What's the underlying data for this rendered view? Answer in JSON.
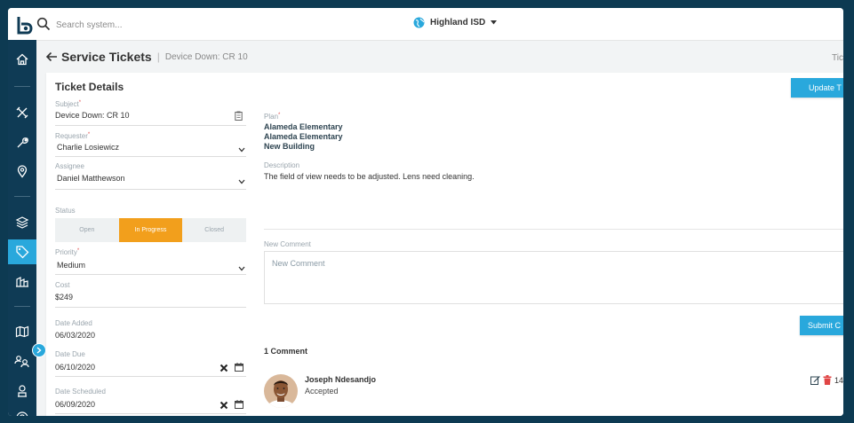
{
  "topbar": {
    "search_placeholder": "Search system...",
    "org_name": "Highland ISD"
  },
  "sidebar": {
    "items": [
      {
        "icon": "home-icon"
      },
      {
        "icon": "tools-icon"
      },
      {
        "icon": "wrench-icon"
      },
      {
        "icon": "location-pin-icon"
      },
      {
        "icon": "layers-icon"
      },
      {
        "icon": "tag-icon",
        "active": true
      },
      {
        "icon": "buildings-icon"
      },
      {
        "icon": "map-icon"
      },
      {
        "icon": "people-icon"
      },
      {
        "icon": "badge-icon"
      },
      {
        "icon": "help-icon"
      }
    ]
  },
  "header": {
    "title": "Service Tickets",
    "subtitle": "Device Down: CR 10",
    "right_clip": "Tic"
  },
  "ticket": {
    "card_title": "Ticket Details",
    "update_label": "Update T",
    "subject_label": "Subject",
    "subject_value": "Device Down: CR 10",
    "requester_label": "Requester",
    "requester_value": "Charlie Losiewicz",
    "assignee_label": "Assignee",
    "assignee_value": "Daniel Matthewson",
    "status_label": "Status",
    "status_options": [
      "Open",
      "In Progress",
      "Closed"
    ],
    "status_selected": "In Progress",
    "priority_label": "Priority",
    "priority_value": "Medium",
    "cost_label": "Cost",
    "cost_value": "$249",
    "date_added_label": "Date Added",
    "date_added_value": "06/03/2020",
    "date_due_label": "Date Due",
    "date_due_value": "06/10/2020",
    "date_scheduled_label": "Date Scheduled",
    "date_scheduled_value": "06/09/2020",
    "plan_label": "Plan",
    "plan_lines": [
      "Alameda Elementary",
      "Alameda Elementary",
      "New Building"
    ],
    "description_label": "Description",
    "description_value": "The field of view needs to be adjusted. Lens need cleaning."
  },
  "comments": {
    "new_label": "New Comment",
    "new_placeholder": "New Comment",
    "submit_label": "Submit C",
    "count_text": "1 Comment",
    "items": [
      {
        "author": "Joseph Ndesandjo",
        "text": "Accepted",
        "meta_clip": "14"
      }
    ]
  },
  "colors": {
    "accent": "#29a8dc",
    "sidebar": "#0f3b55",
    "status_active": "#f29f1c"
  }
}
